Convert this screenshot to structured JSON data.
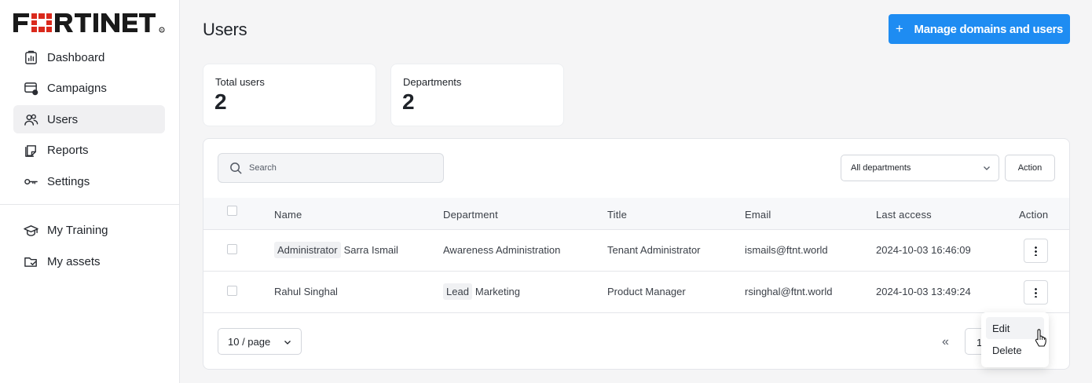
{
  "brand": {
    "logo_text": "FORTINET",
    "accent": "#da291c"
  },
  "sidebar": {
    "items": [
      {
        "label": "Dashboard",
        "icon": "dashboard-icon"
      },
      {
        "label": "Campaigns",
        "icon": "campaigns-icon"
      },
      {
        "label": "Users",
        "icon": "users-icon",
        "active": true
      },
      {
        "label": "Reports",
        "icon": "reports-icon"
      },
      {
        "label": "Settings",
        "icon": "key-icon"
      }
    ],
    "secondary_items": [
      {
        "label": "My Training",
        "icon": "graduation-cap-icon"
      },
      {
        "label": "My assets",
        "icon": "folder-check-icon"
      }
    ]
  },
  "header": {
    "title": "Users",
    "primary_button": {
      "plus": "+",
      "label": "Manage domains and users",
      "color": "#1e8cf2"
    }
  },
  "stats": [
    {
      "label": "Total users",
      "value": "2"
    },
    {
      "label": "Departments",
      "value": "2"
    }
  ],
  "toolbar": {
    "search_placeholder": "Search",
    "department_filter": "All departments",
    "action_label": "Action"
  },
  "table": {
    "columns": [
      "Name",
      "Department",
      "Title",
      "Email",
      "Last access",
      "Action"
    ],
    "rows": [
      {
        "name_tag": "Administrator",
        "name": "Sarra Ismail",
        "department_tag": "",
        "department": "Awareness Administration",
        "title": "Tenant Administrator",
        "email": "ismails@ftnt.world",
        "last_access": "2024-10-03 16:46:09"
      },
      {
        "name_tag": "",
        "name": "Rahul Singhal",
        "department_tag": "Lead",
        "department": "Marketing",
        "title": "Product Manager",
        "email": "rsinghal@ftnt.world",
        "last_access": "2024-10-03 13:49:24"
      }
    ]
  },
  "pagination": {
    "per_page": "10 / page",
    "first_page_symbol": "«",
    "current_page": "1"
  },
  "row_menu": {
    "items": [
      "Edit",
      "Delete"
    ],
    "hovered": "Edit"
  }
}
